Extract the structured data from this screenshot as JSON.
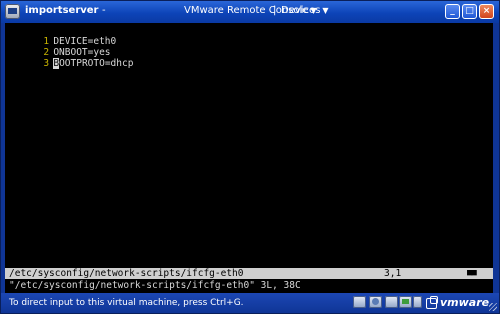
{
  "window": {
    "title": "importserver",
    "title_separator": "-",
    "menus": [
      {
        "label": "VMware Remote Console"
      },
      {
        "label": "Devices"
      }
    ],
    "menu_separator": "|",
    "buttons": {
      "minimize": "_",
      "maximize": "□",
      "close": "×"
    }
  },
  "editor": {
    "lines": [
      {
        "number": "1",
        "text": "DEVICE=eth0"
      },
      {
        "number": "2",
        "text": "ONBOOT=yes"
      },
      {
        "number": "3",
        "cursor_char": "B",
        "text_rest": "OOTPROTO=dhcp"
      }
    ],
    "status": {
      "path": "/etc/sysconfig/network-scripts/ifcfg-eth0",
      "position": "3,1",
      "scroll_indicator": "■■"
    },
    "message": "\"/etc/sysconfig/network-scripts/ifcfg-eth0\" 3L, 38C"
  },
  "statusbar": {
    "hint": "To direct input to this virtual machine, press Ctrl+G.",
    "device_icons": [
      "hard-disk-icon",
      "cd-drive-icon",
      "floppy-icon",
      "network-icon",
      "usb-icon"
    ],
    "logo_text": "vmware"
  },
  "colors": {
    "titlebar": "#0d44b8",
    "terminal_bg": "#000000",
    "line_number": "#c8b400",
    "status_line_bg": "#cfcfcf"
  }
}
